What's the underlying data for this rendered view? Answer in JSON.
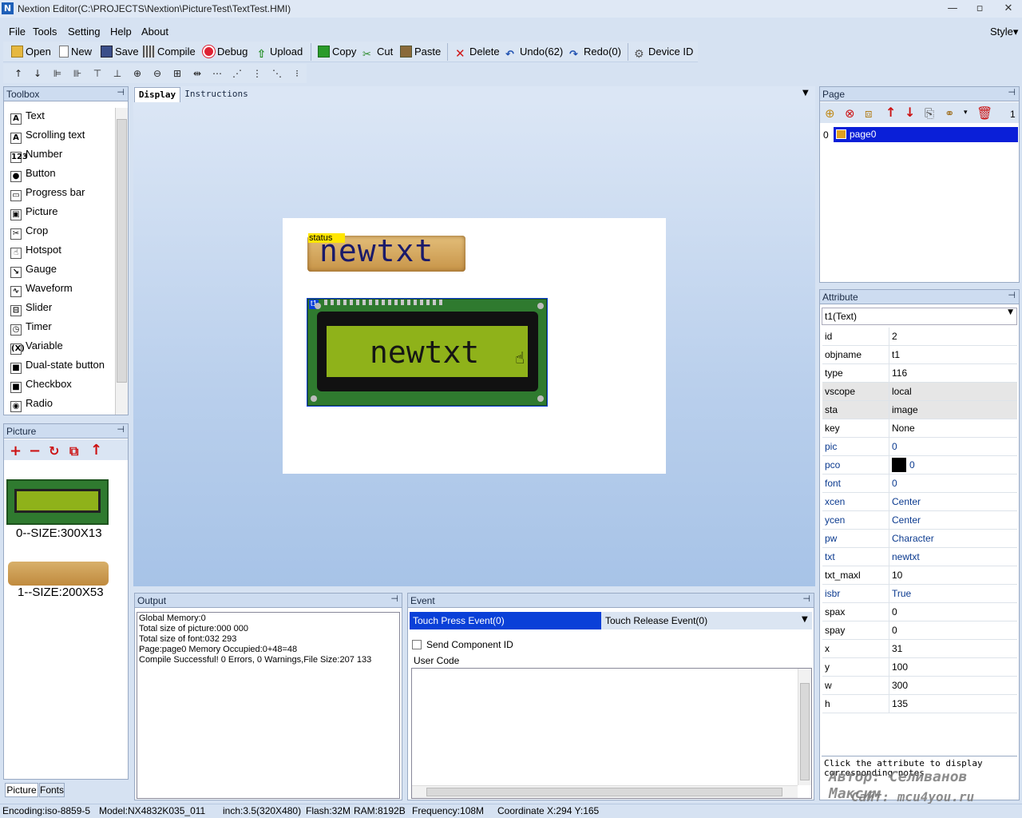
{
  "window": {
    "title": "Nextion Editor(C:\\PROJECTS\\Nextion\\PictureTest\\TextTest.HMI)",
    "logo": "N"
  },
  "menu": [
    "File",
    "Tools",
    "Setting",
    "Help",
    "About"
  ],
  "style_menu": "Style▾",
  "toolbar": {
    "open": "Open",
    "new": "New",
    "save": "Save",
    "compile": "Compile",
    "debug": "Debug",
    "upload": "Upload",
    "copy": "Copy",
    "cut": "Cut",
    "paste": "Paste",
    "delete": "Delete",
    "undo": "Undo(62)",
    "redo": "Redo(0)",
    "device_id": "Device  ID"
  },
  "toolbox": {
    "title": "Toolbox",
    "items": [
      "Text",
      "Scrolling text",
      "Number",
      "Button",
      "Progress bar",
      "Picture",
      "Crop",
      "Hotspot",
      "Gauge",
      "Waveform",
      "Slider",
      "Timer",
      "Variable",
      "Dual-state button",
      "Checkbox",
      "Radio"
    ],
    "icons": [
      "A",
      "A",
      "123",
      "●",
      "▭",
      "▣",
      "✂",
      "☝",
      "↘",
      "∿",
      "⊟",
      "◷",
      "(X)",
      "■",
      "■",
      "◉"
    ]
  },
  "picture_panel": {
    "title": "Picture",
    "items": [
      "0--SIZE:300X13",
      "1--SIZE:200X53"
    ],
    "tabs": [
      "Picture",
      "Fonts"
    ]
  },
  "design": {
    "tabs": [
      "Display",
      "Instructions"
    ]
  },
  "canvas": {
    "status_label": "status",
    "t0_text": "newtxt",
    "t1_badge": "t1",
    "t1_text": "newtxt"
  },
  "page_panel": {
    "title": "Page",
    "count": "1",
    "pages": [
      {
        "index": "0",
        "name": "page0"
      }
    ]
  },
  "attribute_panel": {
    "title": "Attribute",
    "selected": "t1(Text)",
    "rows": [
      {
        "k": "id",
        "v": "2",
        "blue": false,
        "grey": false
      },
      {
        "k": "objname",
        "v": "t1",
        "blue": false,
        "grey": false
      },
      {
        "k": "type",
        "v": "116",
        "blue": false,
        "grey": false
      },
      {
        "k": "vscope",
        "v": "local",
        "blue": false,
        "grey": true
      },
      {
        "k": "sta",
        "v": "image",
        "blue": false,
        "grey": true
      },
      {
        "k": "key",
        "v": "None",
        "blue": false,
        "grey": false
      },
      {
        "k": "pic",
        "v": "0",
        "blue": true,
        "grey": false
      },
      {
        "k": "pco",
        "v": "0",
        "blue": true,
        "grey": false
      },
      {
        "k": "font",
        "v": "0",
        "blue": true,
        "grey": false
      },
      {
        "k": "xcen",
        "v": "Center",
        "blue": true,
        "grey": false
      },
      {
        "k": "ycen",
        "v": "Center",
        "blue": true,
        "grey": false
      },
      {
        "k": "pw",
        "v": "Character",
        "blue": true,
        "grey": false
      },
      {
        "k": "txt",
        "v": "newtxt",
        "blue": true,
        "grey": false
      },
      {
        "k": "txt_maxl",
        "v": "10",
        "blue": false,
        "grey": false
      },
      {
        "k": "isbr",
        "v": "True",
        "blue": true,
        "grey": false
      },
      {
        "k": "spax",
        "v": "0",
        "blue": false,
        "grey": false
      },
      {
        "k": "spay",
        "v": "0",
        "blue": false,
        "grey": false
      },
      {
        "k": "x",
        "v": "31",
        "blue": false,
        "grey": false
      },
      {
        "k": "y",
        "v": "100",
        "blue": false,
        "grey": false
      },
      {
        "k": "w",
        "v": "300",
        "blue": false,
        "grey": false
      },
      {
        "k": "h",
        "v": "135",
        "blue": false,
        "grey": false
      }
    ],
    "note": "Click the attribute to display corresponding notes"
  },
  "watermark": {
    "line1": "Автор: Селиванов Максим",
    "line2": "Сайт: mcu4you.ru"
  },
  "output": {
    "title": "Output",
    "lines": [
      "Global Memory:0",
      "Total size of picture:000 000",
      "Total size of font:032 293",
      "Page:page0 Memory Occupied:0+48=48",
      "Compile Successful! 0 Errors, 0 Warnings,File Size:207 133"
    ]
  },
  "event": {
    "title": "Event",
    "tab_press": "Touch Press Event(0)",
    "tab_release": "Touch Release Event(0)",
    "send_id": "Send Component ID",
    "user_code": "User Code"
  },
  "statusbar": {
    "encoding": "Encoding:iso-8859-5",
    "model": "Model:NX4832K035_011",
    "inch": "inch:3.5(320X480)",
    "flash": "Flash:32M",
    "ram": "RAM:8192B",
    "freq": "Frequency:108M",
    "coord": "Coordinate X:294  Y:165"
  },
  "colors": {
    "accent": "#0a40d8",
    "lcd_board": "#2f7a2f",
    "lcd_screen": "#8fb21a",
    "status_yellow": "#ffe600"
  }
}
